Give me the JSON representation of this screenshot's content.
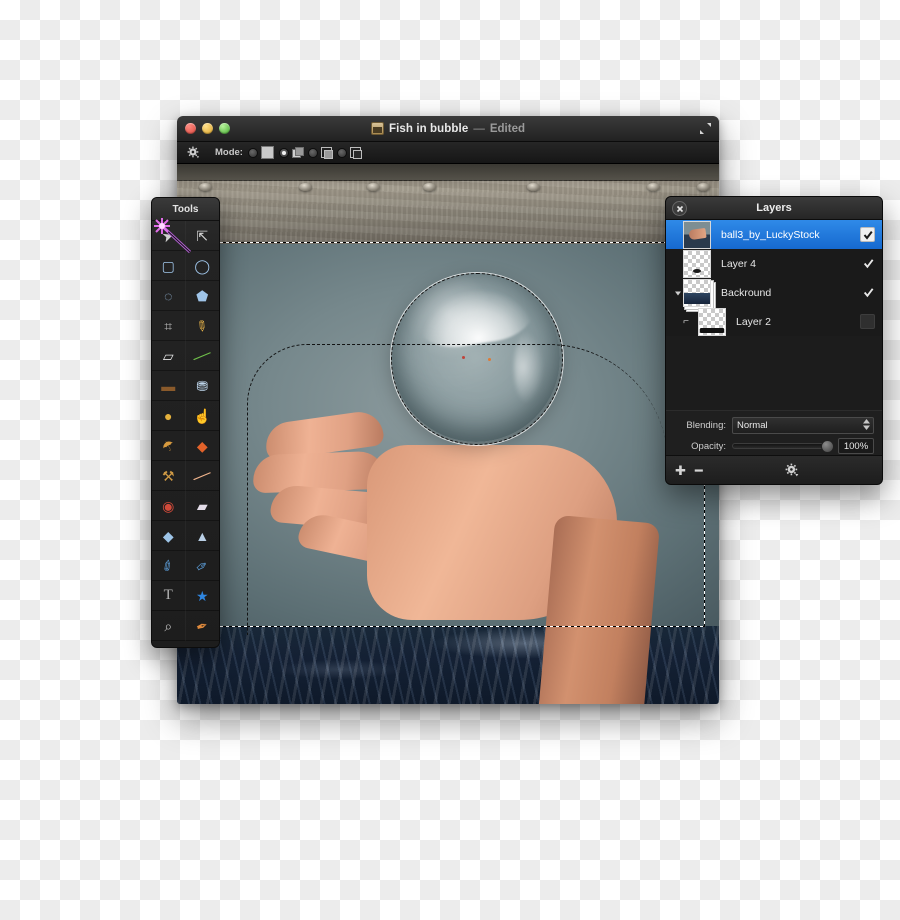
{
  "window": {
    "title": "Fish in bubble",
    "separator": "—",
    "edit_state": "Edited",
    "doc_icon": "document-icon",
    "expand_icon": "expand-fullscreen-icon",
    "traffic_lights": [
      {
        "name": "close",
        "color": "#d9483e"
      },
      {
        "name": "minimize",
        "color": "#d9a127"
      },
      {
        "name": "zoom",
        "color": "#42a72d"
      }
    ]
  },
  "options_bar": {
    "gear_icon": "gear-options-icon",
    "mode_label": "Mode:",
    "modes": [
      {
        "name": "new-selection",
        "icon": "solid-square-icon",
        "selected": false
      },
      {
        "name": "add-to-selection",
        "icon": "two-squares-overlap-icon",
        "selected": true
      },
      {
        "name": "subtract-from-selection",
        "icon": "squares-subtract-icon",
        "selected": false
      },
      {
        "name": "intersect-selection",
        "icon": "squares-intersect-icon",
        "selected": false
      }
    ]
  },
  "tools_panel": {
    "title": "Tools",
    "cursor_icon": "magic-wand-cursor-icon",
    "tools": [
      {
        "name": "move-tool",
        "glyph": "➤"
      },
      {
        "name": "rectangular-marquee-tool",
        "glyph": "⬚"
      },
      {
        "name": "elliptical-marquee-tool",
        "glyph": "◯"
      },
      {
        "name": "lasso-tool",
        "glyph": "◌"
      },
      {
        "name": "polygonal-lasso-tool",
        "glyph": "⬠"
      },
      {
        "name": "crop-tool",
        "glyph": "⌗"
      },
      {
        "name": "pencil-tool",
        "glyph": "✎"
      },
      {
        "name": "eraser-tool",
        "glyph": "▱"
      },
      {
        "name": "paintbrush-tool",
        "glyph": "╱"
      },
      {
        "name": "gradient-tool",
        "glyph": "▬"
      },
      {
        "name": "paint-bucket-tool",
        "glyph": "⛃"
      },
      {
        "name": "dodge-tool",
        "glyph": "●"
      },
      {
        "name": "smudge-tool",
        "glyph": "☝"
      },
      {
        "name": "blur-tool",
        "glyph": "☂"
      },
      {
        "name": "burn-tool",
        "glyph": "◆"
      },
      {
        "name": "clone-stamp-tool",
        "glyph": "⚒"
      },
      {
        "name": "healing-brush-tool",
        "glyph": "╱"
      },
      {
        "name": "red-eye-tool",
        "glyph": "◉"
      },
      {
        "name": "eraser-block-tool",
        "glyph": "▰"
      },
      {
        "name": "water-drop-tool",
        "glyph": "◆"
      },
      {
        "name": "sharpen-tool",
        "glyph": "▲"
      },
      {
        "name": "pen-tool",
        "glyph": "✐"
      },
      {
        "name": "pen-anchor-tool",
        "glyph": "✑"
      },
      {
        "name": "text-tool",
        "glyph": "T"
      },
      {
        "name": "shape-tool",
        "glyph": "★"
      },
      {
        "name": "zoom-tool",
        "glyph": "⌕"
      },
      {
        "name": "eyedropper-tool",
        "glyph": "✒"
      }
    ]
  },
  "layers_panel": {
    "title": "Layers",
    "close_icon": "close-icon",
    "layers": [
      {
        "name": "ball3_by_LuckyStock",
        "visible": true,
        "selected": true,
        "indent": 0,
        "thumb": "hand-ball-thumb",
        "has_disclosure": false,
        "linked": false
      },
      {
        "name": "Layer 4",
        "visible": true,
        "selected": false,
        "indent": 0,
        "thumb": "small-dot-thumb",
        "has_disclosure": false,
        "linked": false
      },
      {
        "name": "Backround",
        "visible": true,
        "selected": false,
        "indent": 0,
        "thumb": "stacked-water-thumb",
        "has_disclosure": true,
        "linked": false
      },
      {
        "name": "Layer 2",
        "visible": false,
        "selected": false,
        "indent": 1,
        "thumb": "black-bar-thumb",
        "has_disclosure": false,
        "linked": true
      }
    ],
    "blending_label": "Blending:",
    "blending_value": "Normal",
    "opacity_label": "Opacity:",
    "opacity_value": "100%",
    "opacity_percent": 100,
    "footer": {
      "add_icon": "plus-icon",
      "remove_icon": "minus-icon",
      "settings_icon": "gear-action-icon"
    }
  },
  "colors": {
    "selection_blue": "#1669cf",
    "panel_dark": "#1c1c1c",
    "titlebar": "#2b2b2b"
  }
}
